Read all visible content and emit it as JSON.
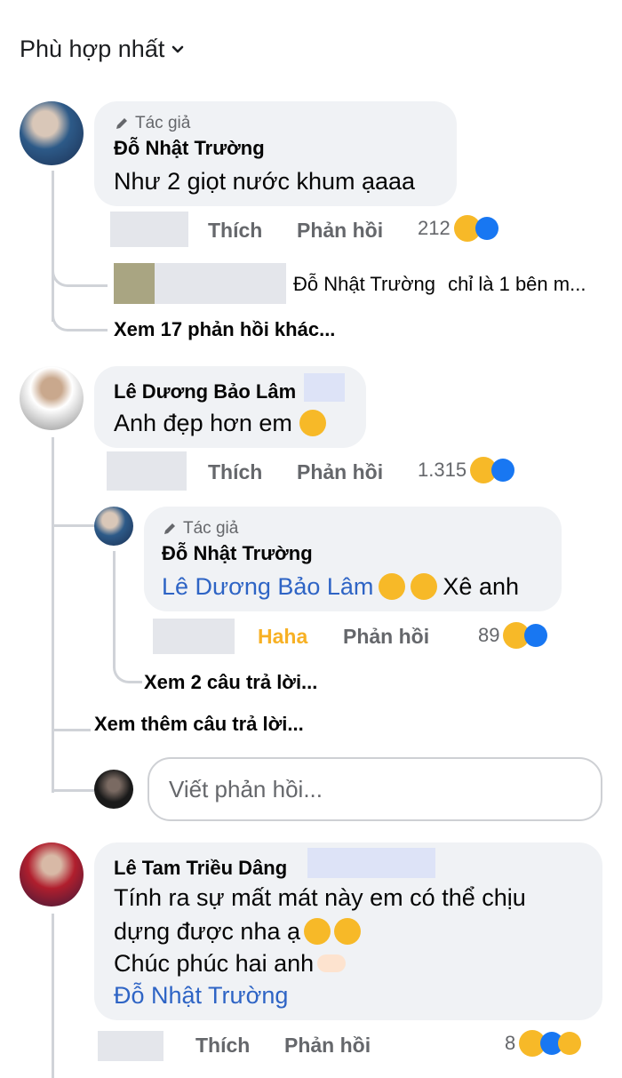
{
  "sort": {
    "label": "Phù hợp nhất"
  },
  "comments": [
    {
      "author_tag": "Tác giả",
      "name": "Đỗ Nhật Trường",
      "text": "Như 2 giọt nước khum ạaaa",
      "like_label": "Thích",
      "reply_label": "Phản hồi",
      "reaction_count": "212",
      "reply_preview": {
        "name": "Đỗ Nhật Trường",
        "text": "chỉ là 1 bên m..."
      },
      "more_replies": "Xem 17 phản hồi khác..."
    },
    {
      "name": "Lê Dương Bảo Lâm",
      "text": "Anh đẹp hơn em",
      "like_label": "Thích",
      "reply_label": "Phản hồi",
      "reaction_count": "1.315",
      "reply": {
        "author_tag": "Tác giả",
        "name": "Đỗ Nhật Trường",
        "mention": "Lê Dương Bảo Lâm",
        "text": "Xê anh",
        "like_label": "Haha",
        "reply_label": "Phản hồi",
        "reaction_count": "89",
        "more_replies": "Xem 2 câu trả lời..."
      },
      "see_more": "Xem thêm câu trả lời...",
      "reply_input_placeholder": "Viết phản hồi..."
    },
    {
      "name": "Lê Tam Triều Dâng",
      "text_line1": "Tính ra sự mất mát này em có thể chịu",
      "text_line2": "dựng được nha ạ",
      "text_line3": "Chúc phúc hai anh",
      "mention": "Đỗ Nhật Trường",
      "like_label": "Thích",
      "reply_label": "Phản hồi",
      "reaction_count": "8"
    }
  ],
  "colors": {
    "link": "#2e64c5",
    "bubble": "#f0f2f5",
    "like": "#1877f2",
    "haha": "#f7b928"
  }
}
